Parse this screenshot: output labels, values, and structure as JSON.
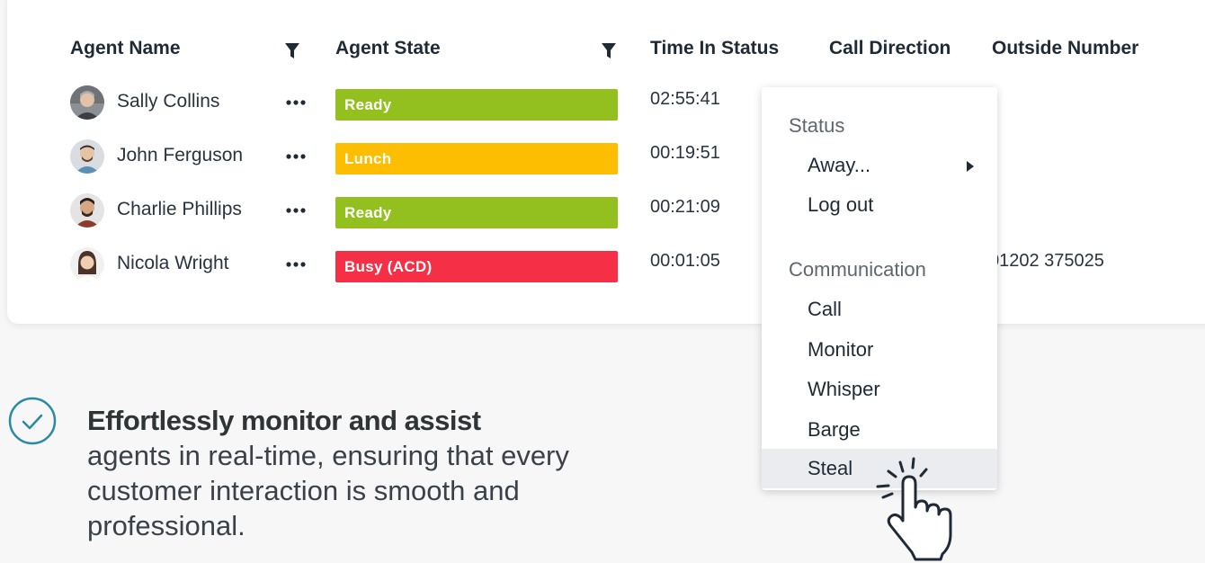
{
  "table": {
    "columns": [
      {
        "label": "Agent Name",
        "filterable": true
      },
      {
        "label": "Agent State",
        "filterable": true
      },
      {
        "label": "Time In Status",
        "filterable": false
      },
      {
        "label": "Call Direction",
        "filterable": false
      },
      {
        "label": "Outside Number",
        "filterable": false
      }
    ],
    "rows": [
      {
        "name": "Sally Collins",
        "state": "Ready",
        "state_color": "#93c01f",
        "time": "02:55:41",
        "outside": ""
      },
      {
        "name": "John Ferguson",
        "state": "Lunch",
        "state_color": "#fdbd00",
        "time": "00:19:51",
        "outside": ""
      },
      {
        "name": "Charlie Phillips",
        "state": "Ready",
        "state_color": "#93c01f",
        "time": "00:21:09",
        "outside": ""
      },
      {
        "name": "Nicola Wright",
        "state": "Busy (ACD)",
        "state_color": "#f52f45",
        "time": "00:01:05",
        "outside": "01202 375025"
      }
    ]
  },
  "context_menu": {
    "sections": [
      {
        "title": "Status",
        "items": [
          {
            "label": "Away...",
            "has_submenu": true
          },
          {
            "label": "Log out",
            "has_submenu": false
          }
        ]
      },
      {
        "title": "Communication",
        "items": [
          {
            "label": "Call",
            "has_submenu": false
          },
          {
            "label": "Monitor",
            "has_submenu": false
          },
          {
            "label": "Whisper",
            "has_submenu": false
          },
          {
            "label": "Barge",
            "has_submenu": false
          },
          {
            "label": "Steal",
            "has_submenu": false,
            "hovered": true
          }
        ]
      }
    ]
  },
  "promo": {
    "headline": "Effortlessly monitor and assist",
    "body": "agents in real-time, ensuring that every customer interaction is smooth and professional."
  },
  "icons": {
    "filter": "filter-icon",
    "more": "more-horizontal-icon",
    "check": "check-circle-icon",
    "cursor": "pointer-hand-icon",
    "submenu": "chevron-right-icon"
  },
  "colors": {
    "ready": "#93c01f",
    "lunch": "#fdbd00",
    "busy": "#f52f45",
    "check_accent": "#2a8aa0",
    "menu_hover": "#ebecf0"
  }
}
